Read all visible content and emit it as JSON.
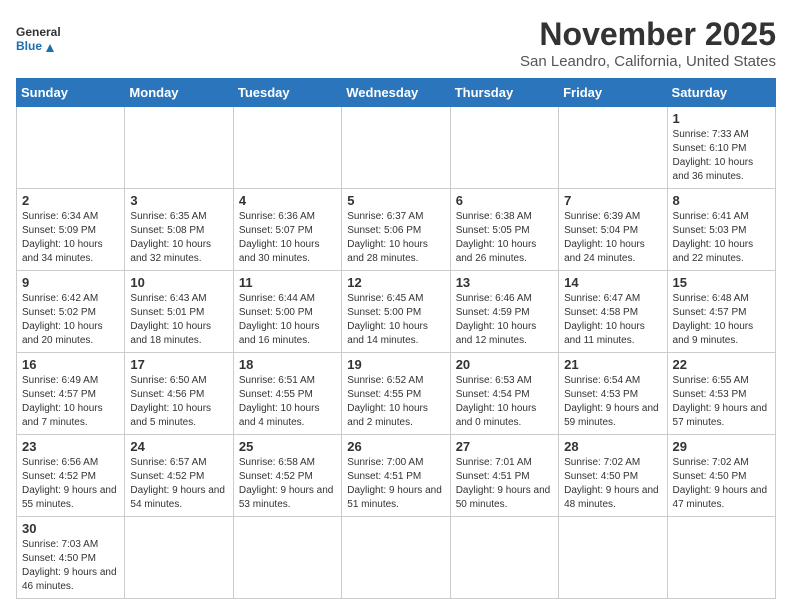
{
  "header": {
    "logo_general": "General",
    "logo_blue": "Blue",
    "title": "November 2025",
    "subtitle": "San Leandro, California, United States"
  },
  "calendar": {
    "days_of_week": [
      "Sunday",
      "Monday",
      "Tuesday",
      "Wednesday",
      "Thursday",
      "Friday",
      "Saturday"
    ],
    "weeks": [
      [
        {
          "day": "",
          "info": ""
        },
        {
          "day": "",
          "info": ""
        },
        {
          "day": "",
          "info": ""
        },
        {
          "day": "",
          "info": ""
        },
        {
          "day": "",
          "info": ""
        },
        {
          "day": "",
          "info": ""
        },
        {
          "day": "1",
          "info": "Sunrise: 7:33 AM\nSunset: 6:10 PM\nDaylight: 10 hours and 36 minutes."
        }
      ],
      [
        {
          "day": "2",
          "info": "Sunrise: 6:34 AM\nSunset: 5:09 PM\nDaylight: 10 hours and 34 minutes."
        },
        {
          "day": "3",
          "info": "Sunrise: 6:35 AM\nSunset: 5:08 PM\nDaylight: 10 hours and 32 minutes."
        },
        {
          "day": "4",
          "info": "Sunrise: 6:36 AM\nSunset: 5:07 PM\nDaylight: 10 hours and 30 minutes."
        },
        {
          "day": "5",
          "info": "Sunrise: 6:37 AM\nSunset: 5:06 PM\nDaylight: 10 hours and 28 minutes."
        },
        {
          "day": "6",
          "info": "Sunrise: 6:38 AM\nSunset: 5:05 PM\nDaylight: 10 hours and 26 minutes."
        },
        {
          "day": "7",
          "info": "Sunrise: 6:39 AM\nSunset: 5:04 PM\nDaylight: 10 hours and 24 minutes."
        },
        {
          "day": "8",
          "info": "Sunrise: 6:41 AM\nSunset: 5:03 PM\nDaylight: 10 hours and 22 minutes."
        }
      ],
      [
        {
          "day": "9",
          "info": "Sunrise: 6:42 AM\nSunset: 5:02 PM\nDaylight: 10 hours and 20 minutes."
        },
        {
          "day": "10",
          "info": "Sunrise: 6:43 AM\nSunset: 5:01 PM\nDaylight: 10 hours and 18 minutes."
        },
        {
          "day": "11",
          "info": "Sunrise: 6:44 AM\nSunset: 5:00 PM\nDaylight: 10 hours and 16 minutes."
        },
        {
          "day": "12",
          "info": "Sunrise: 6:45 AM\nSunset: 5:00 PM\nDaylight: 10 hours and 14 minutes."
        },
        {
          "day": "13",
          "info": "Sunrise: 6:46 AM\nSunset: 4:59 PM\nDaylight: 10 hours and 12 minutes."
        },
        {
          "day": "14",
          "info": "Sunrise: 6:47 AM\nSunset: 4:58 PM\nDaylight: 10 hours and 11 minutes."
        },
        {
          "day": "15",
          "info": "Sunrise: 6:48 AM\nSunset: 4:57 PM\nDaylight: 10 hours and 9 minutes."
        }
      ],
      [
        {
          "day": "16",
          "info": "Sunrise: 6:49 AM\nSunset: 4:57 PM\nDaylight: 10 hours and 7 minutes."
        },
        {
          "day": "17",
          "info": "Sunrise: 6:50 AM\nSunset: 4:56 PM\nDaylight: 10 hours and 5 minutes."
        },
        {
          "day": "18",
          "info": "Sunrise: 6:51 AM\nSunset: 4:55 PM\nDaylight: 10 hours and 4 minutes."
        },
        {
          "day": "19",
          "info": "Sunrise: 6:52 AM\nSunset: 4:55 PM\nDaylight: 10 hours and 2 minutes."
        },
        {
          "day": "20",
          "info": "Sunrise: 6:53 AM\nSunset: 4:54 PM\nDaylight: 10 hours and 0 minutes."
        },
        {
          "day": "21",
          "info": "Sunrise: 6:54 AM\nSunset: 4:53 PM\nDaylight: 9 hours and 59 minutes."
        },
        {
          "day": "22",
          "info": "Sunrise: 6:55 AM\nSunset: 4:53 PM\nDaylight: 9 hours and 57 minutes."
        }
      ],
      [
        {
          "day": "23",
          "info": "Sunrise: 6:56 AM\nSunset: 4:52 PM\nDaylight: 9 hours and 55 minutes."
        },
        {
          "day": "24",
          "info": "Sunrise: 6:57 AM\nSunset: 4:52 PM\nDaylight: 9 hours and 54 minutes."
        },
        {
          "day": "25",
          "info": "Sunrise: 6:58 AM\nSunset: 4:52 PM\nDaylight: 9 hours and 53 minutes."
        },
        {
          "day": "26",
          "info": "Sunrise: 7:00 AM\nSunset: 4:51 PM\nDaylight: 9 hours and 51 minutes."
        },
        {
          "day": "27",
          "info": "Sunrise: 7:01 AM\nSunset: 4:51 PM\nDaylight: 9 hours and 50 minutes."
        },
        {
          "day": "28",
          "info": "Sunrise: 7:02 AM\nSunset: 4:50 PM\nDaylight: 9 hours and 48 minutes."
        },
        {
          "day": "29",
          "info": "Sunrise: 7:02 AM\nSunset: 4:50 PM\nDaylight: 9 hours and 47 minutes."
        }
      ],
      [
        {
          "day": "30",
          "info": "Sunrise: 7:03 AM\nSunset: 4:50 PM\nDaylight: 9 hours and 46 minutes."
        },
        {
          "day": "",
          "info": ""
        },
        {
          "day": "",
          "info": ""
        },
        {
          "day": "",
          "info": ""
        },
        {
          "day": "",
          "info": ""
        },
        {
          "day": "",
          "info": ""
        },
        {
          "day": "",
          "info": ""
        }
      ]
    ]
  }
}
